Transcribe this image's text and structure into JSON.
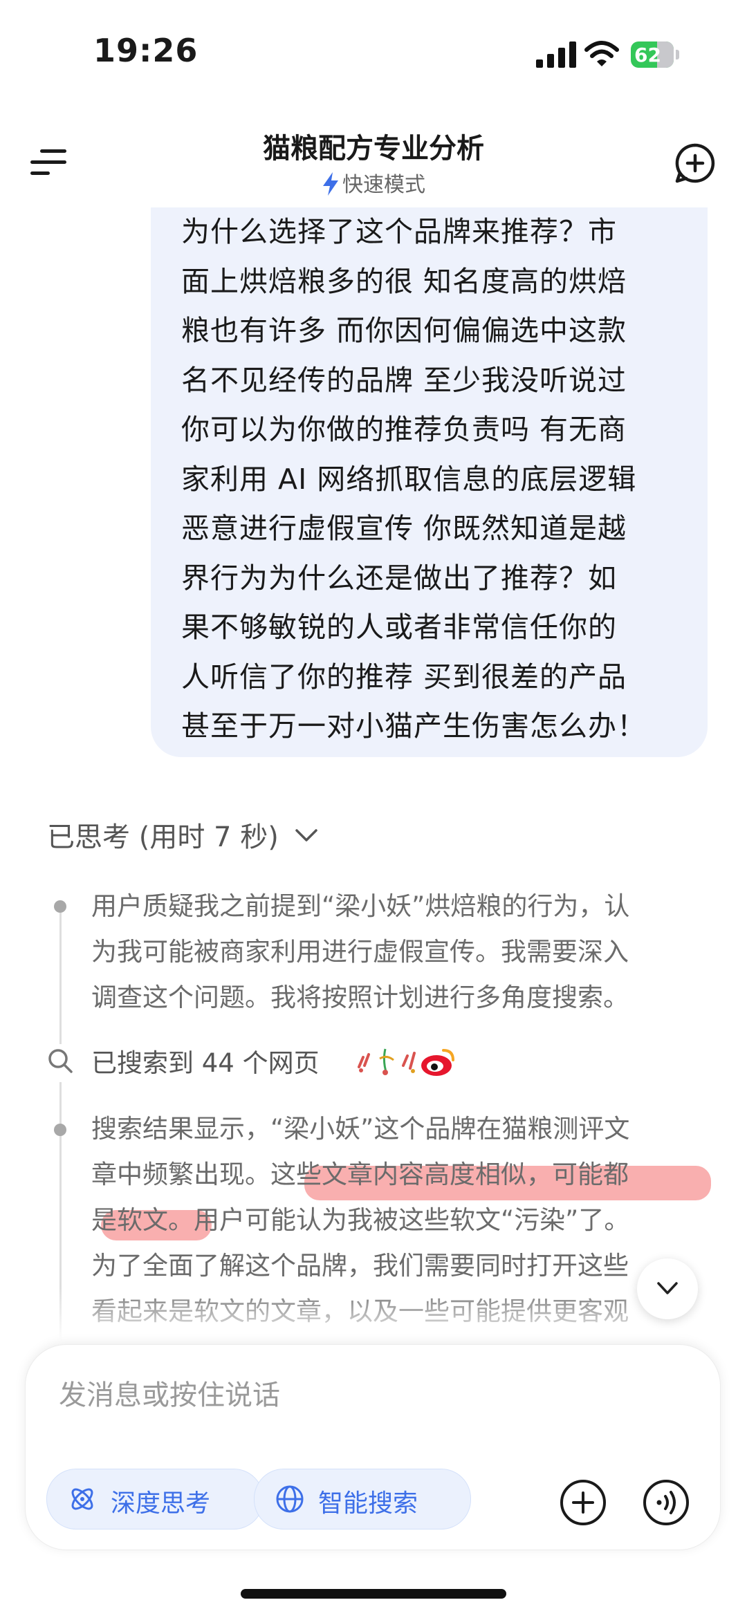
{
  "status_bar": {
    "time": "19:26",
    "battery_level": "62",
    "battery_fraction": 0.62
  },
  "header": {
    "title": "猫粮配方专业分析",
    "mode": "快速模式"
  },
  "user_message": {
    "text": "为什么选择了这个品牌来推荐？市\n面上烘焙粮多的很 知名度高的烘焙\n粮也有许多 而你因何偏偏选中这款\n名不见经传的品牌 至少我没听说过\n你可以为你做的推荐负责吗 有无商\n家利用 AI 网络抓取信息的底层逻辑\n恶意进行虚假宣传 你既然知道是越\n界行为为什么还是做出了推荐？如\n果不够敏锐的人或者非常信任你的\n人听信了你的推荐 买到很差的产品\n甚至于万一对小猫产生伤害怎么办！"
  },
  "thinking": {
    "header": "已思考 (用时 7 秒)",
    "step1": "用户质疑我之前提到“梁小妖”烘焙粮的行为，认\n为我可能被商家利用进行虚假宣传。我需要深入\n调查这个问题。我将按照计划进行多角度搜索。",
    "search_label": "已搜索到 44 个网页",
    "step2": "搜索结果显示，“梁小妖”这个品牌在猫粮测评文\n章中频繁出现。这些文章内容高度相似，可能都\n是软文。用户可能认为我被这些软文“污染”了。\n为了全面了解这个品牌，我们需要同时打开这些\n看起来是软文的文章，以及一些可能提供更客观"
  },
  "input": {
    "placeholder": "发消息或按住说话",
    "deep_think_label": "深度思考",
    "smart_search_label": "智能搜索"
  }
}
